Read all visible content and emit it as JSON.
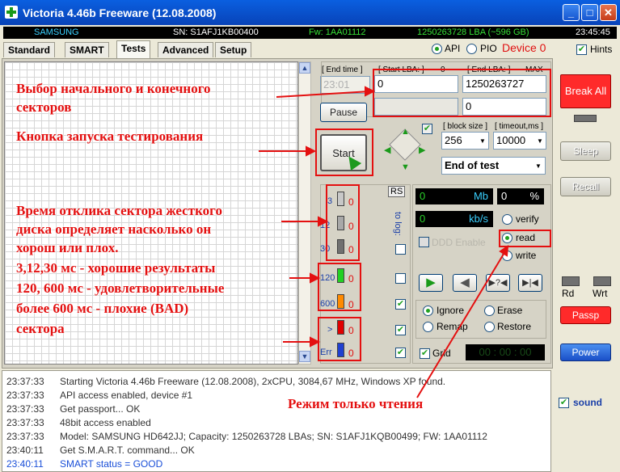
{
  "window": {
    "title": "Victoria 4.46b Freeware (12.08.2008)"
  },
  "infobar": {
    "model": "SAMSUNG",
    "serial": "SN: S1AFJ1KB00400",
    "firmware": "Fw: 1AA01112",
    "capacity": "1250263728 LBA (~596 GB)",
    "time": "23:45:45"
  },
  "tabs": [
    "Standard",
    "SMART",
    "Tests",
    "Advanced",
    "Setup"
  ],
  "mode": {
    "api": "API",
    "pio": "PIO",
    "device": "Device 0",
    "hints": "Hints"
  },
  "lba": {
    "end_time_label": "[ End time ]",
    "end_time_value": "23:01",
    "start_label": "[ Start LBA: ]",
    "start_mid": "0",
    "start_value": "0",
    "end_label": "[ End LBA: ]",
    "max_label": "MAX",
    "end_value": "1250263727",
    "field3": "0"
  },
  "buttons": {
    "pause": "Pause",
    "start": "Start",
    "break_all": "Break All",
    "sleep": "Sleep",
    "recall": "Recall",
    "passp": "Passp",
    "power": "Power"
  },
  "block": {
    "size_label": "[ block size ]",
    "size_value": "256",
    "timeout_label": "[ timeout,ms ]",
    "timeout_value": "10000",
    "end_action": "End of test"
  },
  "stats": {
    "rs": "RS",
    "to_log": "to log:",
    "mb_value": "0",
    "mb_unit": "Mb",
    "pct_value": "0",
    "pct_unit": "%",
    "kbs_value": "0",
    "kbs_unit": "kb/s",
    "ddd": "DDD Enable",
    "grid": "Grid",
    "timer": "00 : 00 : 00"
  },
  "latency": [
    {
      "label": "3",
      "count": "0",
      "color": "#c8c8c8"
    },
    {
      "label": "12",
      "count": "0",
      "color": "#a8a8a8"
    },
    {
      "label": "30",
      "count": "0",
      "color": "#707070"
    },
    {
      "label": "120",
      "count": "0",
      "color": "#22d022"
    },
    {
      "label": "600",
      "count": "0",
      "color": "#ff8a00"
    },
    {
      "label": ">",
      "count": "0",
      "color": "#e00000"
    },
    {
      "label": "Err",
      "count": "0",
      "color": "#2040d0"
    }
  ],
  "modes": {
    "verify": "verify",
    "read": "read",
    "write": "write",
    "ignore": "Ignore",
    "erase": "Erase",
    "remap": "Remap",
    "restore": "Restore"
  },
  "indicators": {
    "rd": "Rd",
    "wrt": "Wrt",
    "sound": "sound"
  },
  "log": [
    {
      "time": "23:37:33",
      "text": "Starting Victoria 4.46b Freeware (12.08.2008), 2xCPU, 3084,67 MHz, Windows XP found.",
      "color": "#333333"
    },
    {
      "time": "23:37:33",
      "text": "API access enabled, device #1",
      "color": "#333333"
    },
    {
      "time": "23:37:33",
      "text": "Get passport... OK",
      "color": "#333333"
    },
    {
      "time": "23:37:33",
      "text": "48bit access enabled",
      "color": "#333333"
    },
    {
      "time": "23:37:33",
      "text": "Model: SAMSUNG HD642JJ; Capacity: 1250263728 LBAs; SN: S1AFJ1KQB00499; FW: 1AA01112",
      "color": "#333333"
    },
    {
      "time": "23:40:11",
      "text": "Get S.M.A.R.T. command... OK",
      "color": "#333333"
    },
    {
      "time": "23:40:11",
      "text": "SMART status = GOOD",
      "color": "#1a4fd8"
    }
  ],
  "annotations": {
    "a1": "Выбор начального и конечного",
    "a1b": "секторов",
    "a2": "Кнопка запуска тестирования",
    "a3": "Время отклика сектора жесткого",
    "a3b": "диска определяет насколько он",
    "a3c": "хорош или плох.",
    "a3d": "3,12,30 мс - хорошие результаты",
    "a3e": "120, 600 мс - удовлетворительные",
    "a3f": "более 600 мс - плохие (BAD)",
    "a3g": "сектора",
    "a4": "Режим только чтения"
  }
}
